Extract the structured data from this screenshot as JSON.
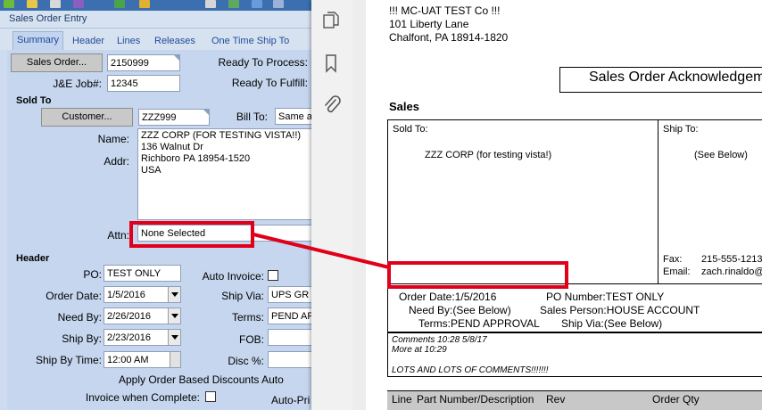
{
  "app": {
    "window_title": "Sales Order Entry",
    "tabs": [
      "Summary",
      "Header",
      "Lines",
      "Releases",
      "One Time Ship To"
    ],
    "sales_order_button": "Sales Order...",
    "sales_order_value": "2150999",
    "ready_to_process_label": "Ready To Process:",
    "je_job_label": "J&E Job#:",
    "je_job_value": "12345",
    "ready_to_fulfill_label": "Ready To Fulfill:",
    "sold_to_section": "Sold To",
    "customer_button": "Customer...",
    "customer_value": "ZZZ999",
    "bill_to_label": "Bill To:",
    "bill_to_value": "Same a",
    "name_label": "Name:",
    "name_value": "ZZZ CORP (FOR TESTING VISTA!!)",
    "addr_label": "Addr:",
    "addr_lines": [
      "136 Walnut Dr",
      "Richboro PA 18954-1520",
      "USA"
    ],
    "attn_label": "Attn:",
    "attn_value": "None Selected",
    "header_section": "Header",
    "po_label": "PO:",
    "po_value": "TEST ONLY",
    "auto_invoice_label": "Auto Invoice:",
    "order_date_label": "Order Date:",
    "order_date_value": "1/5/2016",
    "ship_via_label": "Ship Via:",
    "ship_via_value": "UPS GR",
    "need_by_label": "Need By:",
    "need_by_value": "2/26/2016",
    "terms_label": "Terms:",
    "terms_value": "PEND AP",
    "ship_by_label": "Ship By:",
    "ship_by_value": "2/23/2016",
    "fob_label": "FOB:",
    "ship_by_time_label": "Ship By Time:",
    "ship_by_time_value": "12:00 AM",
    "disc_label": "Disc %:",
    "apply_discounts_label": "Apply Order Based Discounts Auto",
    "invoice_when_complete_label": "Invoice when Complete:",
    "auto_pri_label": "Auto-Pri"
  },
  "document": {
    "company_name": "!!! MC-UAT TEST Co !!!",
    "address_line1": "101 Liberty Lane",
    "address_line2": "Chalfont, PA  18914-1820",
    "title": "Sales Order Acknowledgeme",
    "section_label": "Sales",
    "sold_to_label": "Sold To:",
    "sold_to_name": "ZZZ CORP (for testing vista!)",
    "ship_to_label": "Ship To:",
    "ship_to_value": "(See Below)",
    "fax_label": "Fax:",
    "fax_value": "215-555-1213",
    "email_label": "Email:",
    "email_value": "zach.rinaldo@",
    "order_date": "Order Date:1/5/2016",
    "po_number": "PO Number:TEST ONLY",
    "need_by": "Need By:(See Below)",
    "sales_person": "Sales Person:HOUSE ACCOUNT",
    "terms": "Terms:PEND APPROVAL",
    "ship_via": "Ship Via:(See Below)",
    "comments": [
      "Comments 10:28 5/8/17",
      "More at 10:29",
      "",
      "LOTS AND LOTS OF COMMENTS!!!!!!!"
    ],
    "col_line": "Line",
    "col_part": "Part Number/Description",
    "col_rev": "Rev",
    "col_qty": "Order Qty"
  },
  "colors": {
    "highlight": "#e0001a",
    "app_background": "#c5d6ee",
    "tab_text": "#1f4b99"
  },
  "icons": [
    "copy-pages-icon",
    "bookmark-icon",
    "paperclip-icon",
    "collapse-arrow-icon"
  ]
}
